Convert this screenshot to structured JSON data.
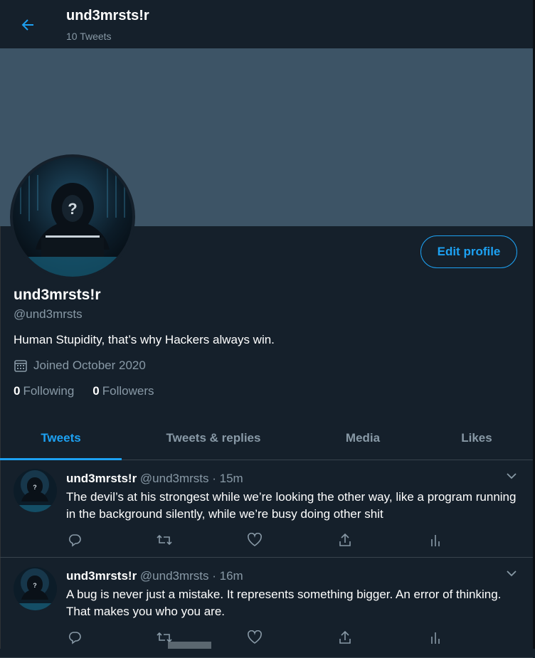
{
  "header": {
    "title": "und3mrsts!r",
    "subtitle": "10 Tweets"
  },
  "profile": {
    "edit_button": "Edit profile",
    "name": "und3mrsts!r",
    "handle": "@und3mrsts",
    "bio": "Human Stupidity, that’s why Hackers always win.",
    "joined": "Joined October 2020",
    "following_count": "0",
    "following_label": "Following",
    "followers_count": "0",
    "followers_label": "Followers"
  },
  "tabs": [
    {
      "label": "Tweets",
      "active": true
    },
    {
      "label": "Tweets & replies",
      "active": false
    },
    {
      "label": "Media",
      "active": false
    },
    {
      "label": "Likes",
      "active": false
    }
  ],
  "tweets": [
    {
      "name": "und3mrsts!r",
      "meta": " @und3mrsts · 15m",
      "text": "The devil’s at his strongest while we’re looking the other way, like a program running in the background silently, while we’re busy doing other shit"
    },
    {
      "name": "und3mrsts!r",
      "meta": " @und3mrsts · 16m",
      "text": "A bug is never just a mistake. It represents something bigger. An error of thinking. That makes you who you are."
    }
  ],
  "icons": {
    "back": "arrow-left-icon",
    "calendar": "calendar-icon",
    "caret": "chevron-down-icon",
    "reply": "reply-icon",
    "retweet": "retweet-icon",
    "like": "heart-icon",
    "share": "share-icon",
    "analytics": "analytics-icon"
  },
  "colors": {
    "background": "#15202b",
    "banner": "#3d5466",
    "accent": "#1da1f2",
    "muted_text": "#8899a6",
    "border": "#38444d"
  }
}
